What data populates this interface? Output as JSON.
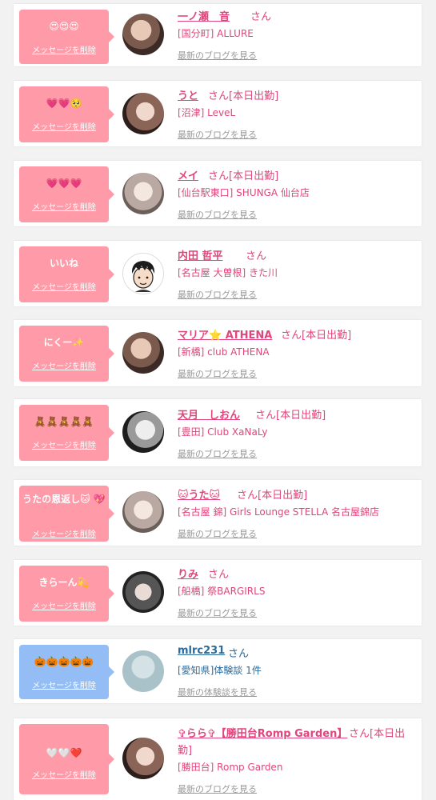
{
  "delete_label": "メッセージを削除",
  "blog_link_label": "最新のブログを見る",
  "review_link_label": "最新の体験談を見る",
  "san_label": "さん",
  "items": [
    {
      "message": "😍😍😍",
      "name": "一ノ瀬　音",
      "suffix": "さん",
      "shop": "[国分町] ALLURE",
      "link": "最新のブログを見る",
      "color": "#ff9aa8"
    },
    {
      "message": "💗💗🥺",
      "name": "うと",
      "suffix": "さん[本日出勤]",
      "shop": "[沼津] LeveL",
      "link": "最新のブログを見る",
      "color": "#ff9aa8"
    },
    {
      "message": "💗💗💗",
      "name": "メイ",
      "suffix": "さん[本日出勤]",
      "shop": "[仙台駅東口] SHUNGA 仙台店",
      "link": "最新のブログを見る",
      "color": "#ff9aa8"
    },
    {
      "message": "いいね",
      "name": "内田 哲平",
      "suffix": "さん",
      "shop": "[名古屋 大曽根] きた川",
      "link": "最新のブログを見る",
      "color": "#ff9aa8"
    },
    {
      "message": "にくー✨",
      "name": "マリア⭐ ATHENA",
      "suffix": "さん[本日出勤]",
      "shop": "[新橋] club ATHENA",
      "link": "最新のブログを見る",
      "color": "#ff9aa8"
    },
    {
      "message": "🧸🧸🧸🧸🧸",
      "name": "天月　しおん",
      "suffix": "さん[本日出勤]",
      "shop": "[豊田] Club XaNaLy",
      "link": "最新のブログを見る",
      "color": "#ff9aa8"
    },
    {
      "message": "うたの恩返し🐱 💖",
      "name": "🐱うた🐱",
      "suffix": "さん[本日出勤]",
      "shop": "[名古屋 錦] Girls Lounge STELLA 名古屋錦店",
      "link": "最新のブログを見る",
      "color": "#ff9aa8"
    },
    {
      "message": "きらーん💫",
      "name": "りみ",
      "suffix": "さん",
      "shop": "[船橋] 祭BARGIRLS",
      "link": "最新のブログを見る",
      "color": "#ff9aa8"
    },
    {
      "message": "🎃🎃🎃🎃🎃",
      "name": "mlrc231",
      "suffix": "さん",
      "shop": "[愛知県]体験談 1件",
      "link": "最新の体験談を見る",
      "color": "#94bdf5"
    },
    {
      "message": "🤍🤍❤️",
      "name": "✞らら✞【勝田台Romp Garden】",
      "suffix": "さん[本日出",
      "suffix2": "勤]",
      "shop": "[勝田台] Romp Garden",
      "link": "最新のブログを見る",
      "color": "#ff9aa8"
    }
  ]
}
